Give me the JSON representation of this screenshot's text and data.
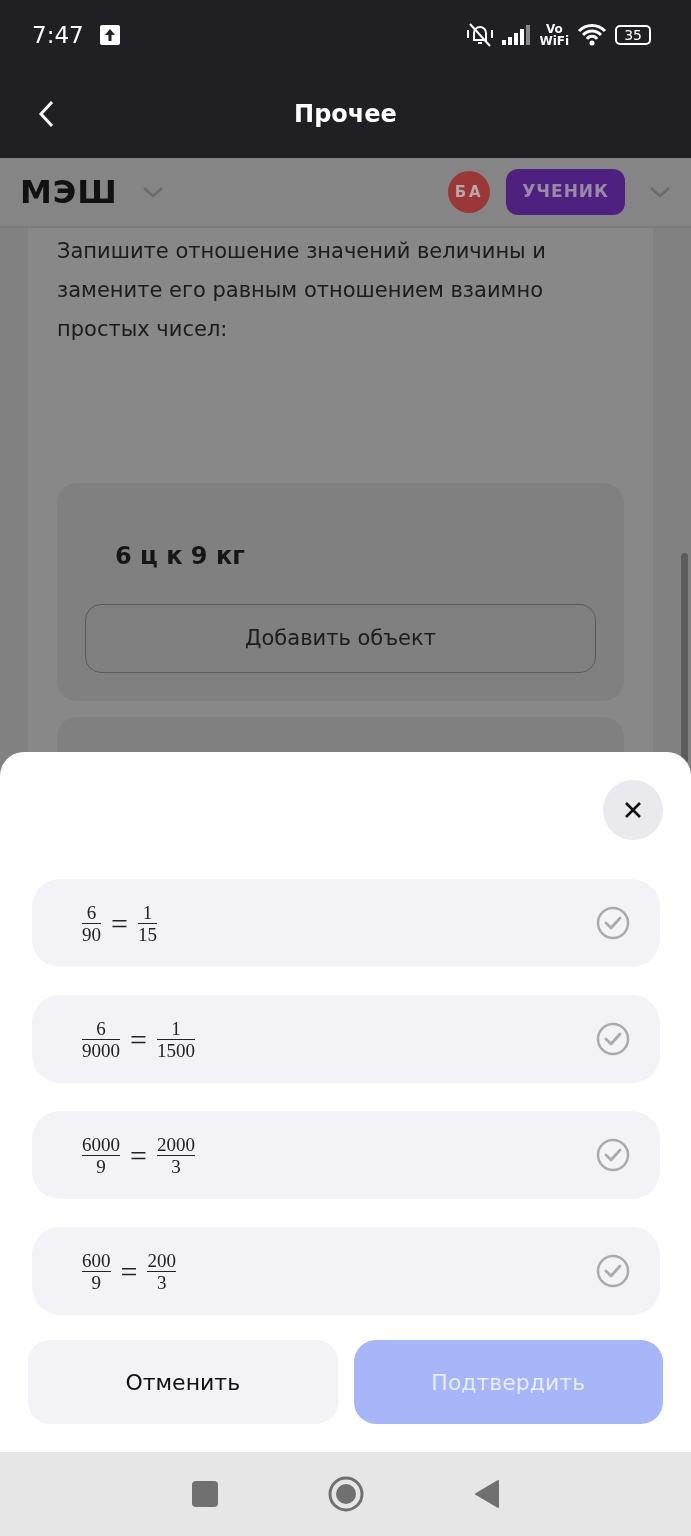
{
  "status_bar": {
    "time": "7:47",
    "vowifi_top": "Vo",
    "vowifi_bottom": "WiFi",
    "battery": "35"
  },
  "app_bar": {
    "title": "Прочее"
  },
  "header": {
    "logo": "МЭШ",
    "avatar_initials": "БА",
    "role": "УЧЕНИК"
  },
  "task": {
    "question": "Запишите отношение значений величины и замените его равным отношением взаимно простых чисел:",
    "item": "6 ц к 9 кг",
    "add_button": "Добавить объект"
  },
  "sheet": {
    "options": [
      {
        "lhs": {
          "num": "6",
          "den": "90"
        },
        "operator": "=",
        "rhs": {
          "num": "1",
          "den": "15"
        },
        "selected": false
      },
      {
        "lhs": {
          "num": "6",
          "den": "9000"
        },
        "operator": "=",
        "rhs": {
          "num": "1",
          "den": "1500"
        },
        "selected": false
      },
      {
        "lhs": {
          "num": "6000",
          "den": "9"
        },
        "operator": "=",
        "rhs": {
          "num": "2000",
          "den": "3"
        },
        "selected": false
      },
      {
        "lhs": {
          "num": "600",
          "den": "9"
        },
        "operator": "=",
        "rhs": {
          "num": "200",
          "den": "3"
        },
        "selected": false
      }
    ],
    "cancel": "Отменить",
    "confirm": {
      "label": "Подтвердить",
      "disabled": true
    }
  }
}
